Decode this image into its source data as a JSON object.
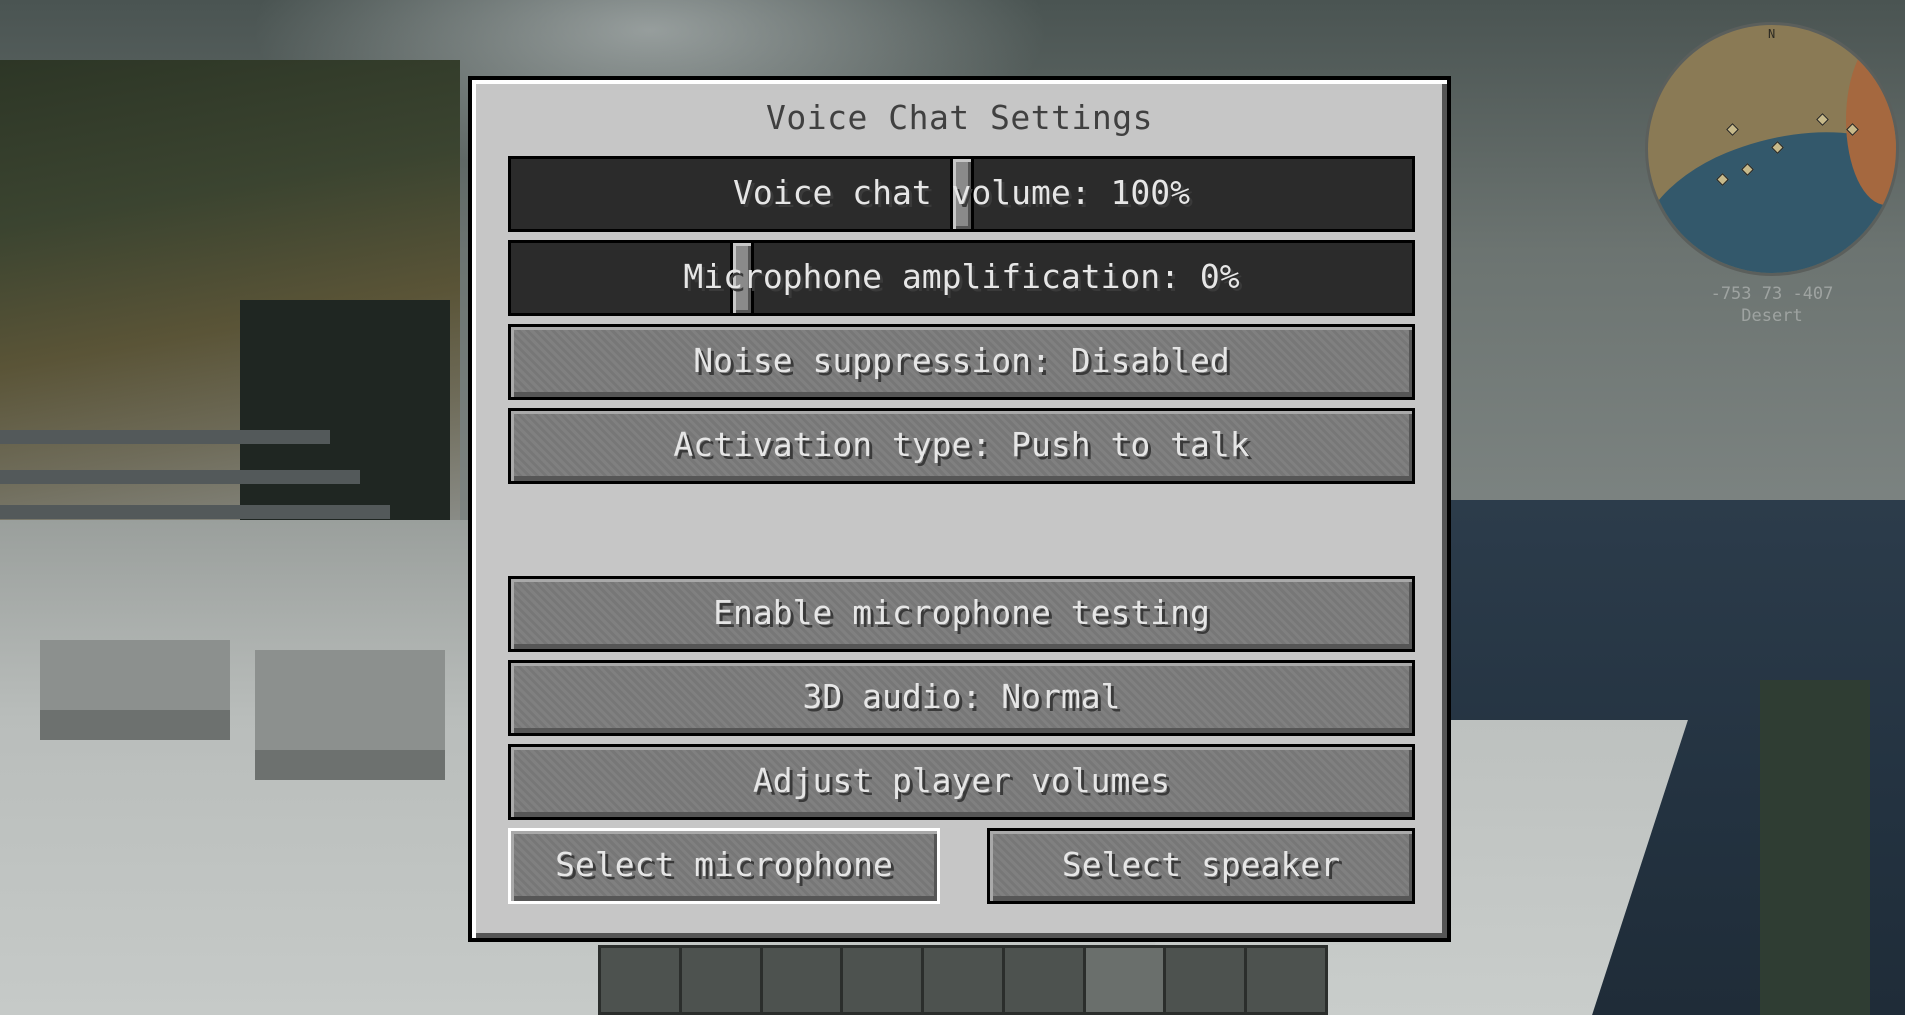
{
  "dialog": {
    "title": "Voice Chat Settings",
    "sliders": [
      {
        "label": "Voice chat volume: 100%",
        "value": 0.5
      },
      {
        "label": "Microphone amplification: 0%",
        "value": 0.25
      }
    ],
    "buttons": {
      "noise_suppression": "Noise suppression: Disabled",
      "activation_type": "Activation type: Push to talk",
      "mic_testing": "Enable microphone testing",
      "audio_3d": "3D audio: Normal",
      "player_volumes": "Adjust player volumes",
      "select_microphone": "Select microphone",
      "select_speaker": "Select speaker"
    }
  },
  "minimap": {
    "north": "N",
    "coords": "-753 73 -407",
    "biome": "Desert"
  },
  "hotbar": {
    "slots": 9,
    "selected_slot": 7
  },
  "colors": {
    "dialog_bg": "#c6c6c6",
    "button_bg": "#7b7b7b",
    "slider_bg": "#2b2b2b",
    "text": "#e6e6e6",
    "title_text": "#404040"
  }
}
